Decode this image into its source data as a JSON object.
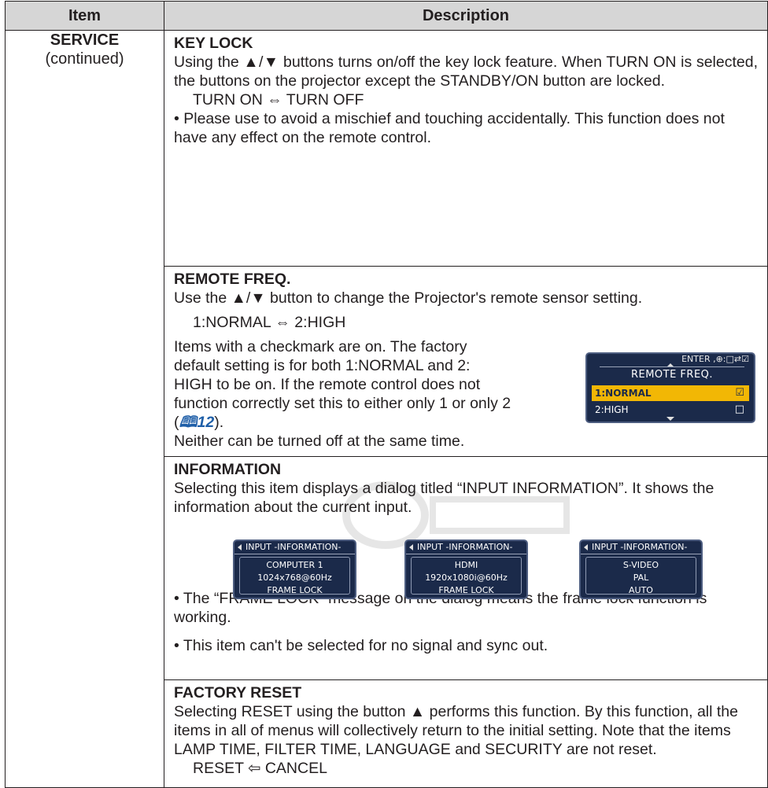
{
  "table": {
    "header_item": "Item",
    "header_description": "Description",
    "item_name": "SERVICE",
    "item_sub": "(continued)"
  },
  "key_lock": {
    "title": "KEY LOCK",
    "body": "Using the ▲/▼ buttons turns on/off the key lock feature. When TURN ON is selected, the buttons on the projector except the STANDBY/ON button are locked.",
    "options": "TURN ON ⇔ TURN OFF",
    "note": "• Please use to avoid a mischief and touching accidentally. This function does not have any effect on the remote control."
  },
  "remote_freq": {
    "title": "REMOTE FREQ.",
    "body": "Use the ▲/▼ button to change the Projector's remote sensor setting.",
    "options": "1:NORMAL ⇔ 2:HIGH",
    "desc_before_ref": "Items with a checkmark are on. The factory default setting is for both 1:NORMAL and 2: HIGH to be on.  If the remote control does not function correctly set this to either only 1 or only 2 (",
    "ref_icon": "book-icon",
    "ref_page": "12",
    "desc_after_ref": ").",
    "note": "Neither can be turned off at the same time.",
    "osd": {
      "hint": "ENTER ,⊕:□⇄☑",
      "title": "REMOTE FREQ.",
      "rows": [
        {
          "label": "1:NORMAL",
          "check": "☑",
          "selected": true
        },
        {
          "label": "2:HIGH",
          "check": "□",
          "selected": false
        }
      ]
    }
  },
  "information": {
    "title": "INFORMATION",
    "body": "Selecting this item displays a dialog titled “INPUT INFORMATION”. It shows the information about the current input.",
    "dialogs": [
      {
        "title": "INPUT -INFORMATION-",
        "lines": [
          "COMPUTER 1",
          "1024x768@60Hz",
          "FRAME LOCK"
        ]
      },
      {
        "title": "INPUT -INFORMATION-",
        "lines": [
          "HDMI",
          "1920x1080i@60Hz",
          "FRAME LOCK"
        ]
      },
      {
        "title": "INPUT -INFORMATION-",
        "lines": [
          "S-VIDEO",
          "PAL",
          "AUTO"
        ]
      }
    ],
    "note1": "• The “FRAME LOCK” message on the dialog means the frame lock function is working.",
    "note2": "• This item can't be selected for no signal and sync out."
  },
  "factory_reset": {
    "title": "FACTORY RESET",
    "body": "Selecting RESET using the button ▲ performs this function. By this function, all the items in all of menus will collectively return to the initial setting. Note that the items LAMP TIME, FILTER TIME, LANGUAGE and SECURITY are not reset.",
    "options": "RESET ⇦ CANCEL"
  },
  "colors": {
    "header_bg": "#d6d6d6",
    "osd_bg": "#1b2a4a",
    "osd_highlight": "#f2b705",
    "ref_blue": "#1f5fa8"
  }
}
